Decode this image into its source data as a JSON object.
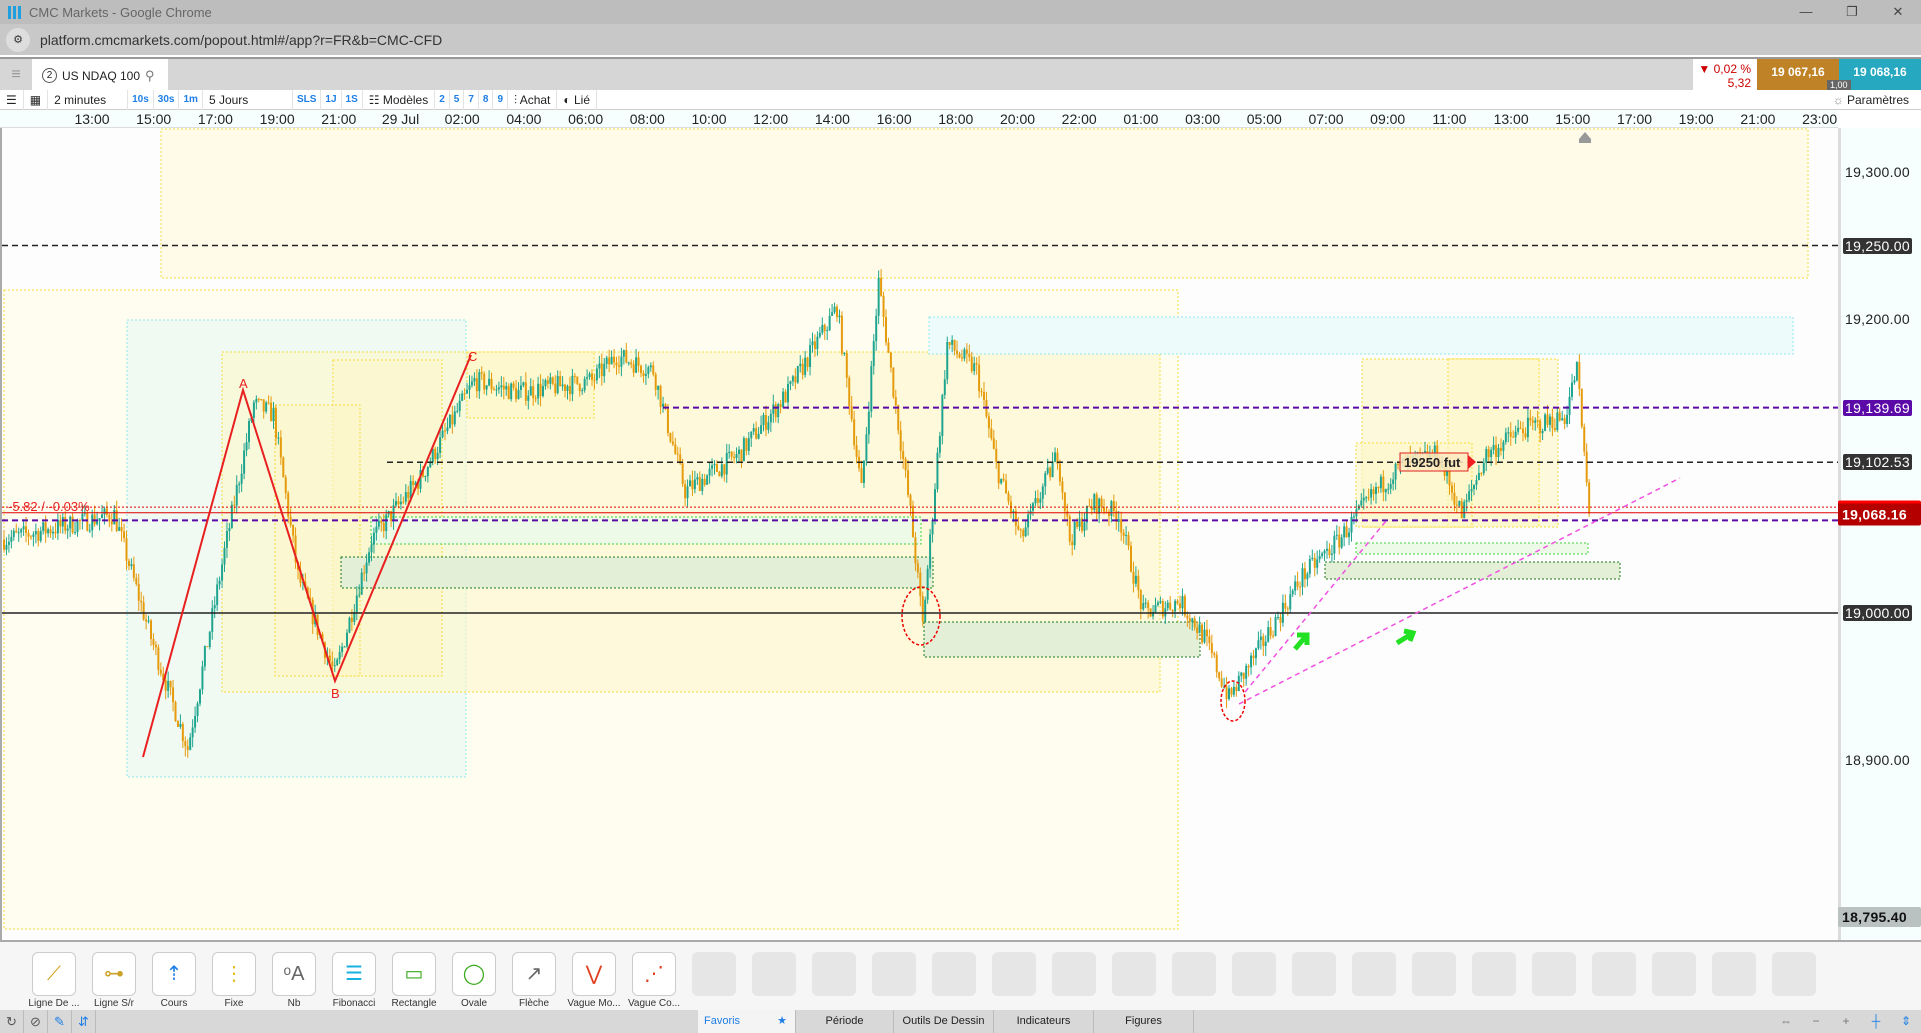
{
  "window": {
    "title": "CMC Markets - Google Chrome",
    "url": "platform.cmcmarkets.com/popout.html#/app?r=FR&b=CMC-CFD"
  },
  "tab": {
    "badge": "2",
    "instrument": "US NDAQ 100"
  },
  "quote": {
    "change_pct": "▼ 0,02 %",
    "change_pts": "5,32",
    "sell": "19 067,16",
    "buy": "19 068,16",
    "spread": "1,00"
  },
  "toolbar": {
    "interval": "2 minutes",
    "q1": "10s",
    "q2": "30s",
    "q3": "1m",
    "range": "5 Jours",
    "sls": "SLS",
    "d1": "1J",
    "w1": "1S",
    "templates": "Modèles",
    "n2": "2",
    "n5": "5",
    "n7": "7",
    "n8": "8",
    "n9": "9",
    "buy": "Achat",
    "linked": "Lié",
    "settings": "Paramètres"
  },
  "time_labels": [
    "13:00",
    "15:00",
    "17:00",
    "19:00",
    "21:00",
    "29 Jul",
    "02:00",
    "04:00",
    "06:00",
    "08:00",
    "10:00",
    "12:00",
    "14:00",
    "16:00",
    "18:00",
    "20:00",
    "22:00",
    "01:00",
    "03:00",
    "05:00",
    "07:00",
    "09:00",
    "11:00",
    "13:00",
    "15:00",
    "17:00",
    "19:00",
    "21:00",
    "23:00"
  ],
  "price_axis": {
    "ticks": [
      19300,
      19200,
      18900
    ],
    "tick_labels": [
      "19,300.00",
      "19,200.00",
      "18,900.00"
    ],
    "bottom": "18,795.40"
  },
  "levels": [
    {
      "price": 19250,
      "label": "19,250.00",
      "style": "dark"
    },
    {
      "price": 19139.69,
      "label": "19,139.69",
      "style": "purple"
    },
    {
      "price": 19102.53,
      "label": "19,102.53",
      "style": "dark"
    },
    {
      "price": 19000,
      "label": "19,000.00",
      "style": "dark"
    },
    {
      "price": 19068.16,
      "label": "19,068.16",
      "style": "red"
    }
  ],
  "annotations": {
    "change_label": "-5.82 / -0.03%",
    "fut_label": "19250 fut",
    "wave_a": "A",
    "wave_b": "B",
    "wave_c": "C"
  },
  "colors": {
    "up": "#1fa58f",
    "down": "#e59b0c",
    "purple": "#5b0aa8",
    "red": "#e00000"
  },
  "price_path": [
    [
      0,
      19050
    ],
    [
      45,
      19067
    ],
    [
      60,
      18983
    ],
    [
      75,
      18908
    ],
    [
      90,
      19042
    ],
    [
      102,
      19142
    ],
    [
      110,
      19135
    ],
    [
      120,
      19025
    ],
    [
      135,
      18958
    ],
    [
      150,
      19050
    ],
    [
      170,
      19092
    ],
    [
      192,
      19158
    ],
    [
      210,
      19150
    ],
    [
      240,
      19158
    ],
    [
      250,
      19175
    ],
    [
      265,
      19165
    ],
    [
      278,
      19083
    ],
    [
      300,
      19108
    ],
    [
      320,
      19150
    ],
    [
      340,
      19208
    ],
    [
      350,
      19083
    ],
    [
      357,
      19225
    ],
    [
      370,
      19068
    ],
    [
      375,
      18992
    ],
    [
      385,
      19183
    ],
    [
      397,
      19165
    ],
    [
      405,
      19100
    ],
    [
      415,
      19050
    ],
    [
      430,
      19108
    ],
    [
      435,
      19050
    ],
    [
      445,
      19075
    ],
    [
      455,
      19067
    ],
    [
      465,
      19000
    ],
    [
      480,
      19008
    ],
    [
      490,
      18983
    ],
    [
      500,
      18942
    ],
    [
      515,
      18983
    ],
    [
      530,
      19025
    ],
    [
      545,
      19050
    ],
    [
      560,
      19083
    ],
    [
      570,
      19100
    ],
    [
      585,
      19108
    ],
    [
      595,
      19067
    ],
    [
      605,
      19108
    ],
    [
      620,
      19125
    ],
    [
      637,
      19133
    ],
    [
      642,
      19167
    ],
    [
      647,
      19067
    ]
  ],
  "drawing_tools": [
    "Ligne De ...",
    "Ligne S/r",
    "Cours",
    "Fixe",
    "Nb",
    "Fibonacci",
    "Rectangle",
    "Ovale",
    "Flèche",
    "Vague Mo...",
    "Vague Co..."
  ],
  "bottom_tabs": {
    "favorites": "Favoris",
    "period": "Période",
    "drawing": "Outils De Dessin",
    "indicators": "Indicateurs",
    "shapes": "Figures"
  }
}
